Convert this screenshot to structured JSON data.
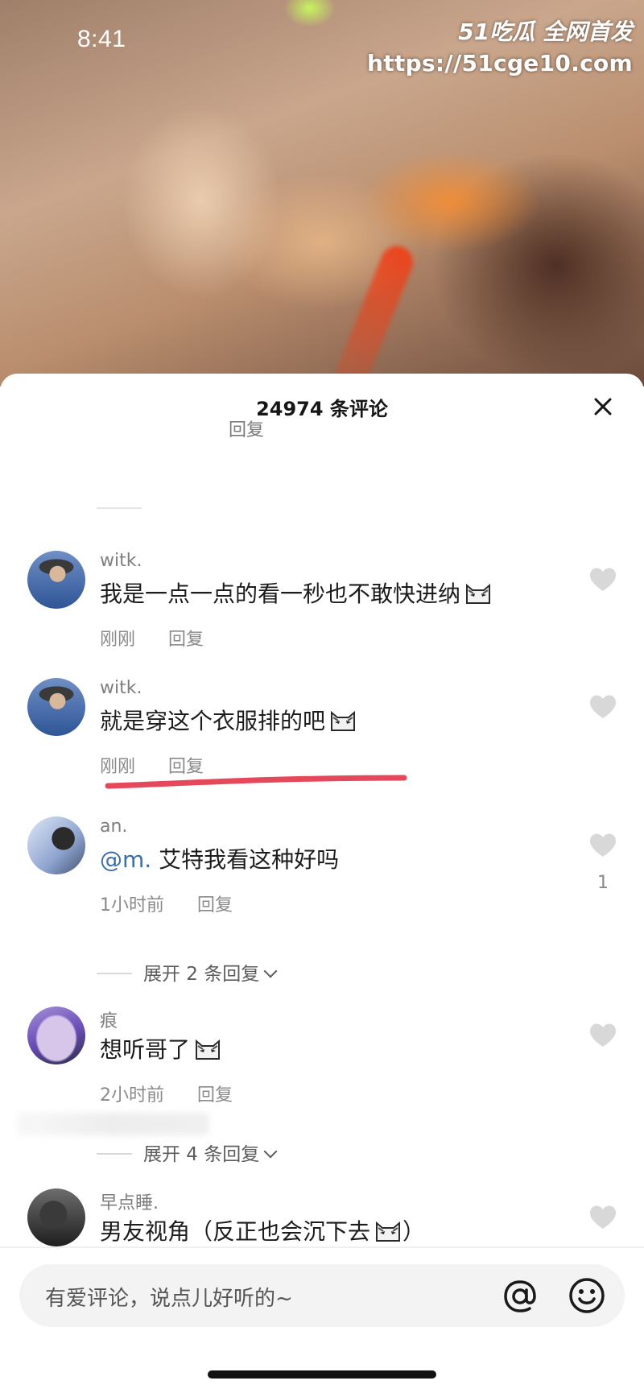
{
  "status_bar": {
    "time": "8:41"
  },
  "watermark": {
    "brand": "51吃瓜 全网首发",
    "url": "https://51cge10.com"
  },
  "sheet": {
    "title": "24974 条评论"
  },
  "partial_comment": {
    "reply_label": "回复"
  },
  "comments": [
    {
      "username": "witk.",
      "text": "我是一点一点的看一秒也不敢快进纳",
      "emoji": "cat-emoji",
      "time": "刚刚",
      "reply_label": "回复",
      "like_count": ""
    },
    {
      "username": "witk.",
      "text": "就是穿这个衣服排的吧",
      "emoji": "cat-emoji",
      "time": "刚刚",
      "reply_label": "回复",
      "like_count": ""
    },
    {
      "username": "an.",
      "mention": "@m.",
      "text": " 艾特我看这种好吗",
      "time": "1小时前",
      "reply_label": "回复",
      "like_count": "1",
      "expand_label": "展开 2 条回复"
    },
    {
      "username": "痕",
      "text": "想听哥了",
      "emoji": "cat-emoji",
      "time": "2小时前",
      "reply_label": "回复",
      "like_count": "",
      "expand_label": "展开 4 条回复"
    },
    {
      "username": "早点睡.",
      "text": "男友视角（反正也会沉下去",
      "text_end": "）",
      "emoji": "cat-emoji"
    }
  ],
  "input": {
    "placeholder": "有爱评论，说点儿好听的~"
  },
  "colors": {
    "highlight_stroke": "#e5485a",
    "mention": "#3c6ea8",
    "like_heart": "#d8d8d8"
  },
  "icons": [
    "close-icon",
    "heart-icon",
    "at-icon",
    "smiley-icon",
    "chevron-down-icon",
    "cat-emoji"
  ]
}
